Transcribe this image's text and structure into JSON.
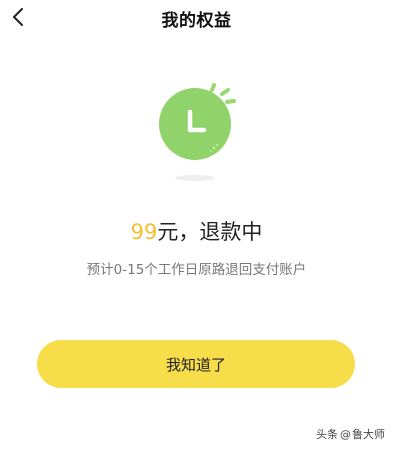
{
  "header": {
    "title": "我的权益",
    "back_icon": "chevron-left-icon"
  },
  "illustration": {
    "icon": "clock-icon",
    "circle_color": "#8fd36a",
    "ray_color": "#9ad970",
    "shadow_color": "#eeeeee"
  },
  "status": {
    "amount": "99",
    "amount_color": "#f5c02c",
    "text": "元，退款中",
    "subtitle": "预计0-15个工作日原路退回支付账户"
  },
  "actions": {
    "confirm_label": "我知道了",
    "confirm_color": "#f7dd4a"
  },
  "watermark": {
    "prefix": "头条",
    "at": "@",
    "name": "鲁大师"
  }
}
